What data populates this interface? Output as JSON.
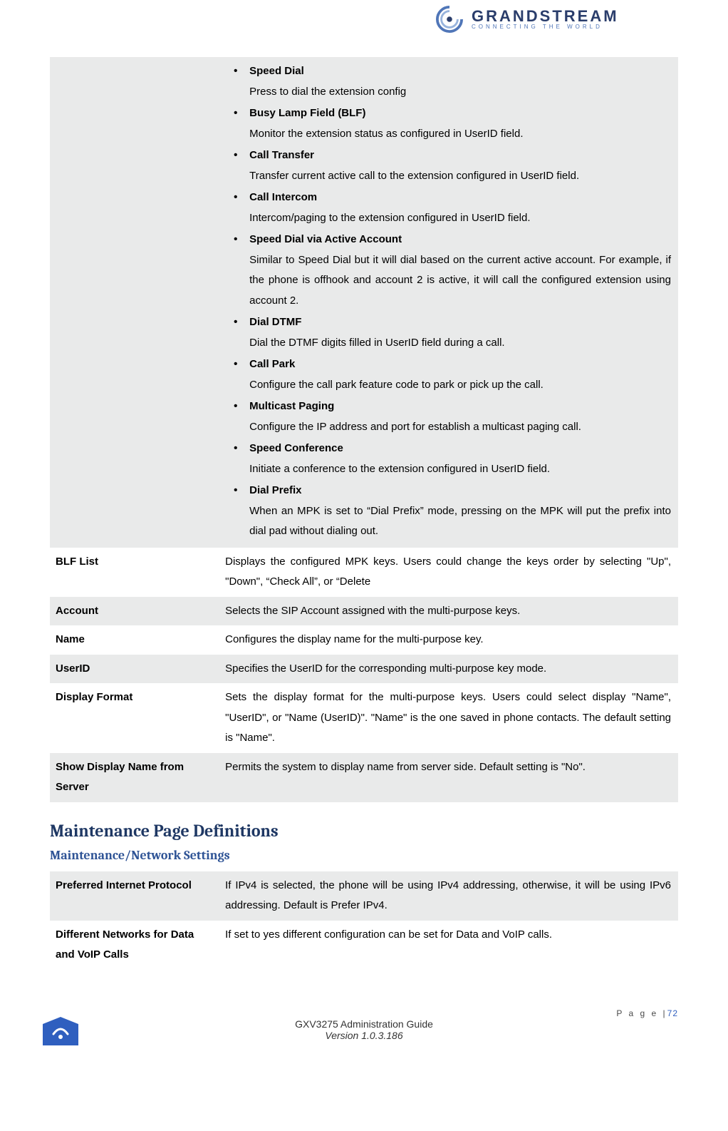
{
  "brand": {
    "name": "GRANDSTREAM",
    "tagline": "CONNECTING THE WORLD"
  },
  "key_modes": [
    {
      "title": "Speed Dial",
      "desc": "Press to dial the extension config"
    },
    {
      "title": "Busy Lamp Field (BLF)",
      "desc": "Monitor the extension status as configured in UserID field."
    },
    {
      "title": "Call Transfer",
      "desc": "Transfer current active call to the extension configured in UserID field."
    },
    {
      "title": "Call Intercom",
      "desc": "Intercom/paging to the extension configured in UserID field."
    },
    {
      "title": "Speed Dial via Active Account",
      "desc": "Similar to Speed Dial but it will dial based on the current active account. For example, if the phone is offhook and account 2 is active, it will call the configured extension using account 2."
    },
    {
      "title": "Dial DTMF",
      "desc": "Dial the DTMF digits filled in UserID field during a call."
    },
    {
      "title": "Call Park",
      "desc": "Configure the call park feature code to park or pick up the call."
    },
    {
      "title": "Multicast Paging",
      "desc": "Configure the IP address and port for establish a multicast paging call."
    },
    {
      "title": "Speed Conference",
      "desc": "Initiate a conference to the extension configured in UserID field."
    },
    {
      "title": "Dial Prefix",
      "desc": "When an MPK is set to “Dial Prefix” mode, pressing on the MPK will put the prefix into dial pad without dialing out."
    }
  ],
  "table1": [
    {
      "label": "BLF List",
      "desc": "Displays the configured MPK keys. Users could change the keys order by selecting \"Up\", \"Down\", “Check All”, or “Delete"
    },
    {
      "label": "Account",
      "desc": "Selects the SIP Account assigned with the multi-purpose keys."
    },
    {
      "label": "Name",
      "desc": "Configures the display name for the multi-purpose key."
    },
    {
      "label": "UserID",
      "desc": "Specifies the UserID for the corresponding multi-purpose key mode."
    },
    {
      "label": "Display Format",
      "desc": "Sets the display format for the multi-purpose keys. Users could select display \"Name\", \"UserID\", or \"Name (UserID)\". \"Name\" is the one saved in phone contacts. The default setting is \"Name\"."
    },
    {
      "label": "Show Display Name from Server",
      "desc": "Permits the system to display name from server side. Default setting is \"No\"."
    }
  ],
  "headings": {
    "h1": "Maintenance Page Definitions",
    "h2": "Maintenance/Network Settings"
  },
  "table2": [
    {
      "label": "Preferred Internet Protocol",
      "desc": "If IPv4 is selected, the phone will be using IPv4 addressing, otherwise, it will be using IPv6 addressing. Default is Prefer IPv4."
    },
    {
      "label": "Different Networks for Data and VoIP Calls",
      "desc": "If set to yes different configuration can be set for Data and VoIP calls."
    }
  ],
  "footer": {
    "page_label": "P a g e  |",
    "page_num": "72",
    "line1": "GXV3275 Administration Guide",
    "line2": "Version 1.0.3.186"
  }
}
